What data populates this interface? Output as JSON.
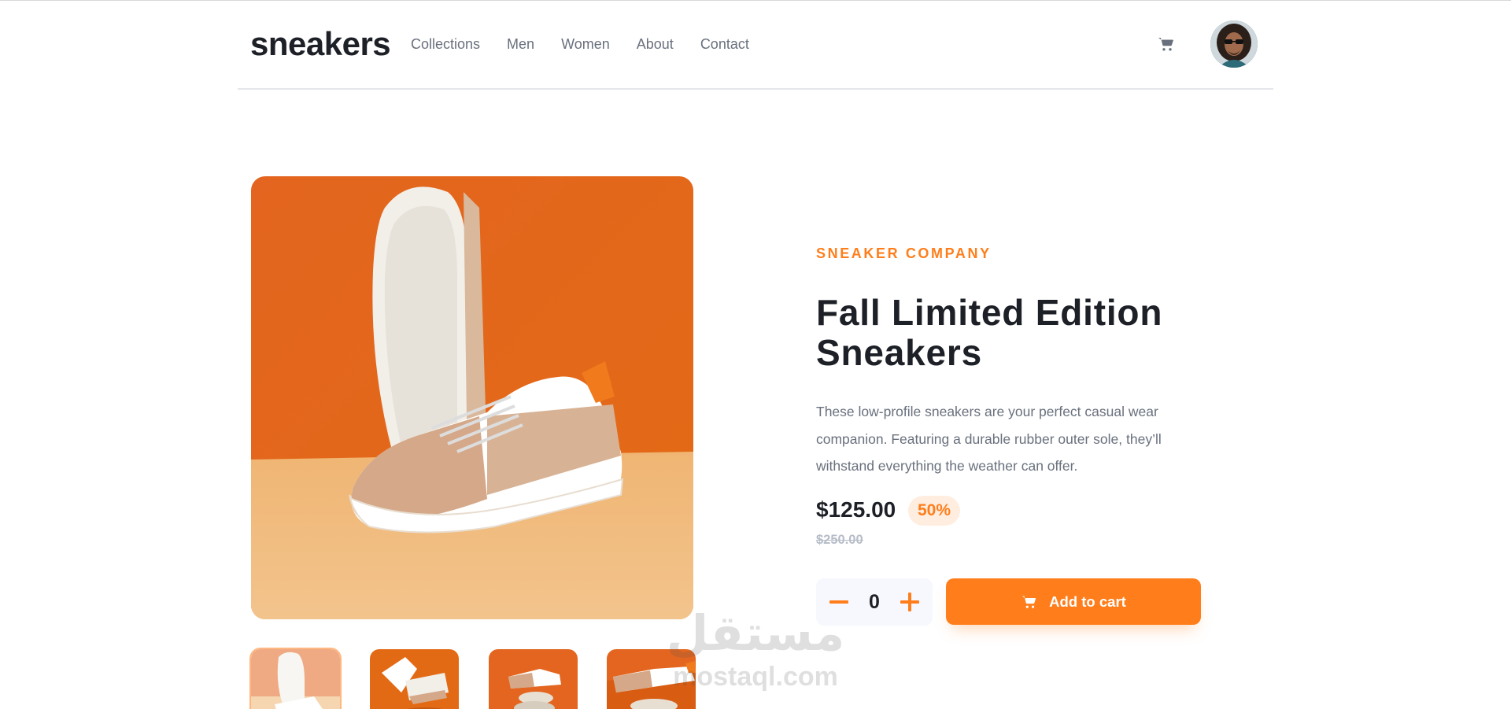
{
  "header": {
    "logo": "sneakers",
    "nav": [
      "Collections",
      "Men",
      "Women",
      "About",
      "Contact"
    ],
    "cart_icon": "cart-icon",
    "avatar_icon": "user-avatar"
  },
  "product": {
    "company": "SNEAKER COMPANY",
    "title": "Fall Limited Edition Sneakers",
    "description": "These low-profile sneakers are your perfect casual wear companion. Featuring a durable rubber outer sole, they’ll withstand everything the weather can offer.",
    "price": "$125.00",
    "discount": "50%",
    "old_price": "$250.00",
    "quantity": "0",
    "add_to_cart": "Add to cart"
  },
  "gallery": {
    "selected_index": 0,
    "thumbnail_count": 4
  },
  "watermark": {
    "arabic": "مستقل",
    "latin": "mostaql.com"
  },
  "colors": {
    "accent": "#ff7e1b",
    "accent_light": "#ffede0",
    "text_dark": "#1d2026",
    "text_grey": "#69707d",
    "old_price": "#b6bcc8",
    "qty_bg": "#f6f8fd"
  }
}
